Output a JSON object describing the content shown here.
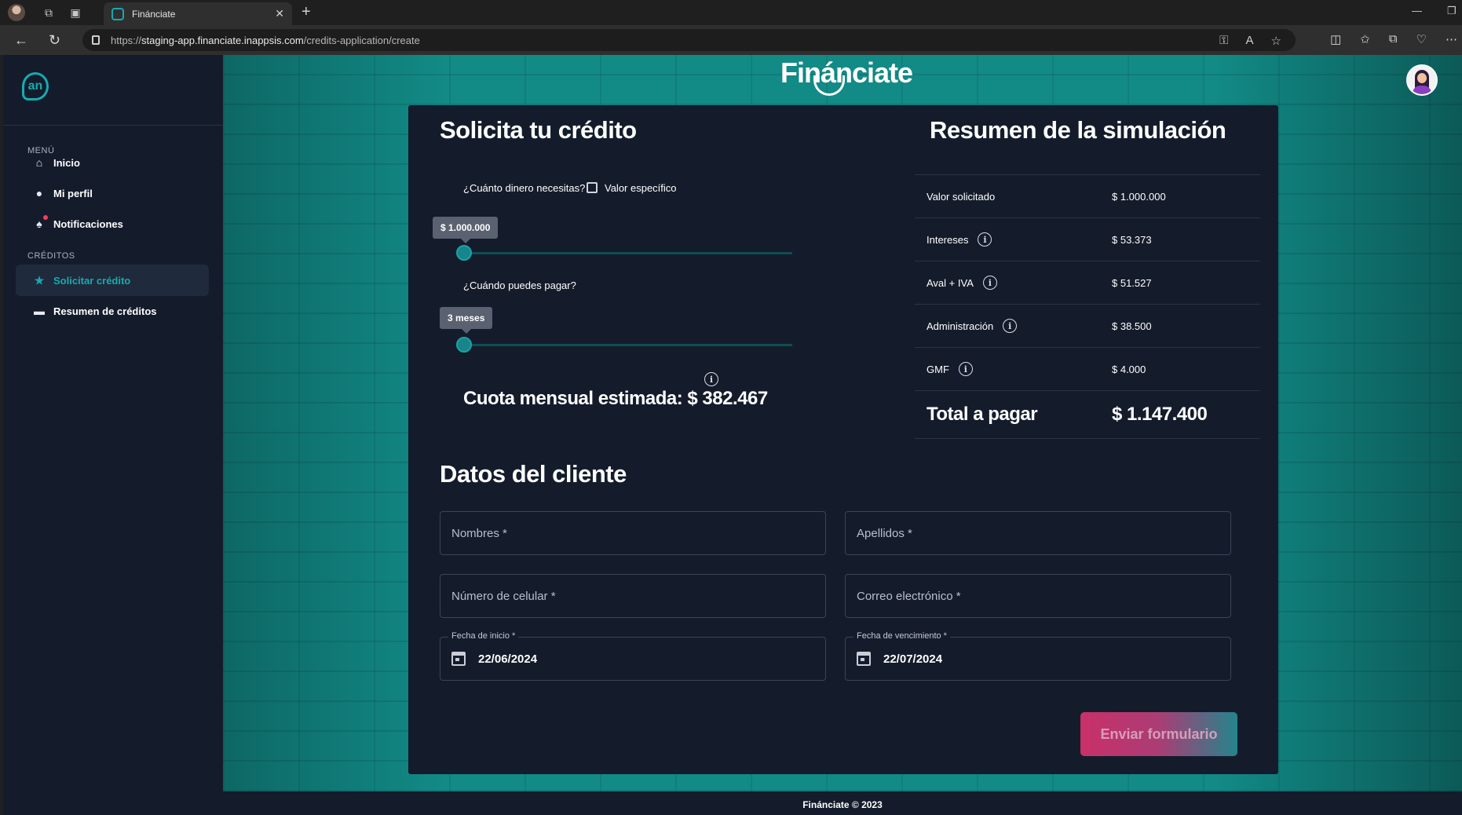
{
  "browser": {
    "tab_title": "Fináncia",
    "tab_title_full": "Fináncia​te",
    "url_prefix": "https://",
    "url_host": "staging-app.financiate.inappsis.com",
    "url_path": "/credits-application/create"
  },
  "sidebar": {
    "menu_title": "MENÚ",
    "menu_items": [
      {
        "label": "Inicio",
        "icon": "home-icon"
      },
      {
        "label": "Mi perfil",
        "icon": "user-icon"
      },
      {
        "label": "Notificaciones",
        "icon": "bell-icon"
      }
    ],
    "credits_title": "CRÉDITOS",
    "credit_items": [
      {
        "label": "Solicitar crédito",
        "icon": "star-icon",
        "active": true
      },
      {
        "label": "Resumen de créditos",
        "icon": "card-icon",
        "active": false
      }
    ]
  },
  "header": {
    "brand": "Fináncia​te"
  },
  "form": {
    "title": "Solicita tu crédito",
    "amount_question": "¿Cuánto dinero necesitas?",
    "specific_value_label": "Valor específico",
    "amount_value": "$ 1.000.000",
    "amount_fraction": 0.0,
    "term_question": "¿Cuándo puedes pagar?",
    "term_value": "3 meses",
    "term_fraction": 0.0,
    "monthly_fee": "Cuota mensual estimada: $ 382.467"
  },
  "summary": {
    "title": "Resumen de la simulación",
    "rows": [
      {
        "label": "Valor solicitado",
        "value": "$ 1.000.000",
        "info": false
      },
      {
        "label": "Intereses",
        "value": "$ 53.373",
        "info": true
      },
      {
        "label": "Aval + IVA",
        "value": "$ 51.527",
        "info": true
      },
      {
        "label": "Administración",
        "value": "$ 38.500",
        "info": true
      },
      {
        "label": "GMF",
        "value": "$ 4.000",
        "info": true
      }
    ],
    "total_label": "Total a pagar",
    "total_value": "$ 1.147.400"
  },
  "client": {
    "title": "Datos del cliente",
    "first_name_placeholder": "Nombres *",
    "last_name_placeholder": "Apellidos *",
    "phone_placeholder": "Número de celular *",
    "email_placeholder": "Correo electrónico *",
    "start_date_label": "Fecha de inicio *",
    "start_date_value": "22/06/2024",
    "end_date_label": "Fecha de vencimiento *",
    "end_date_value": "22/07/2024",
    "submit_label": "Enviar formulario"
  },
  "footer": {
    "text": "Fináncia​te © 2023"
  },
  "colors": {
    "accent": "#17aab0",
    "sidebar_bg": "#141c2c",
    "card_bg": "#141c2c",
    "button_pink": "#d9326e",
    "button_teal": "#258e95"
  }
}
